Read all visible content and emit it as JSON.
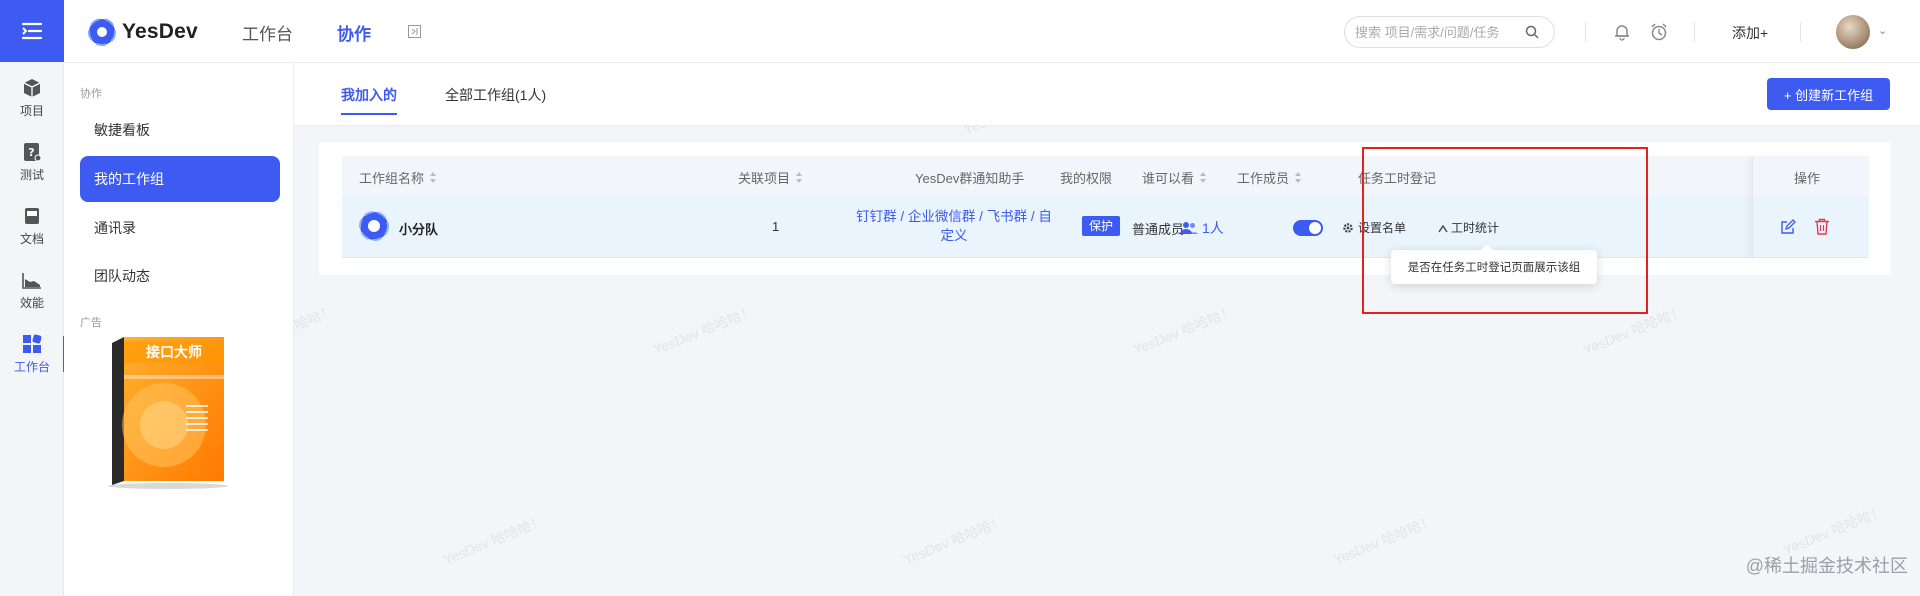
{
  "rail": {
    "items": [
      {
        "label": "项目"
      },
      {
        "label": "测试"
      },
      {
        "label": "文档"
      },
      {
        "label": "效能"
      },
      {
        "label": "工作台"
      }
    ]
  },
  "topbar": {
    "brand": "YesDev",
    "nav": [
      "工作台",
      "协作"
    ],
    "search_placeholder": "搜索 项目/需求/问题/任务",
    "add_label": "添加+"
  },
  "subside": {
    "group_label": "协作",
    "items": [
      "敏捷看板",
      "我的工作组",
      "通讯录",
      "团队动态"
    ],
    "ad_label": "广告",
    "ad_title": "接口大师"
  },
  "tabs": {
    "items": [
      "我加入的",
      "全部工作组(1人)"
    ],
    "create_button": "+ 创建新工作组"
  },
  "table": {
    "headers": [
      "工作组名称",
      "关联项目",
      "YesDev群通知助手",
      "我的权限",
      "谁可以看",
      "工作成员",
      "任务工时登记",
      "操作"
    ],
    "row": {
      "name": "小分队",
      "projects": "1",
      "notify": "钉钉群 / 企业微信群 / 飞书群 / 自定义",
      "permission": "普通成员",
      "visibility": "保护",
      "members": "1人",
      "set_list": "设置名单",
      "hour_stat": "工时统计"
    },
    "tooltip": "是否在任务工时登记页面展示该组"
  },
  "watermark_text": "YesDev 哈哈哈！",
  "credit": "@稀土掘金技术社区",
  "colors": {
    "accent": "#3d5af1",
    "highlight": "#e5211d",
    "danger": "#e5394b"
  }
}
